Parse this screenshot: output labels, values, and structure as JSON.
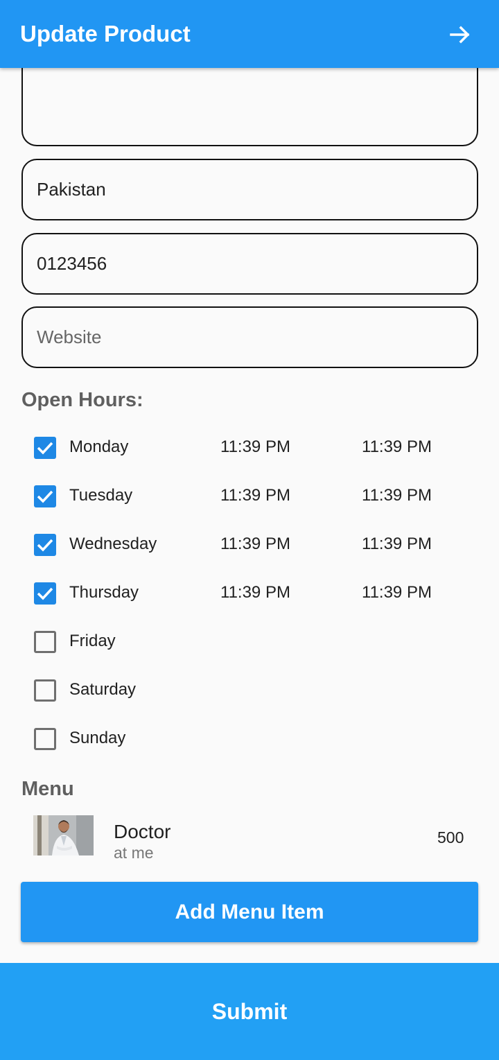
{
  "appbar": {
    "title": "Update Product",
    "action_icon": "arrow-right-icon"
  },
  "form": {
    "description": {
      "value": ""
    },
    "country": {
      "value": "Pakistan"
    },
    "phone": {
      "value": "0123456"
    },
    "website": {
      "placeholder": "Website"
    }
  },
  "open_hours": {
    "label": "Open Hours:",
    "days": [
      {
        "name": "Monday",
        "checked": true,
        "open": "11:39 PM",
        "close": "11:39 PM"
      },
      {
        "name": "Tuesday",
        "checked": true,
        "open": "11:39 PM",
        "close": "11:39 PM"
      },
      {
        "name": "Wednesday",
        "checked": true,
        "open": "11:39 PM",
        "close": "11:39 PM"
      },
      {
        "name": "Thursday",
        "checked": true,
        "open": "11:39 PM",
        "close": "11:39 PM"
      },
      {
        "name": "Friday",
        "checked": false
      },
      {
        "name": "Saturday",
        "checked": false
      },
      {
        "name": "Sunday",
        "checked": false
      }
    ]
  },
  "menu": {
    "label": "Menu",
    "items": [
      {
        "title": "Doctor",
        "subtitle": "at me",
        "price": "500"
      }
    ],
    "add_button": "Add Menu Item"
  },
  "submit": {
    "label": "Submit"
  },
  "colors": {
    "primary": "#2196f3",
    "checkbox": "#1e88e5"
  }
}
